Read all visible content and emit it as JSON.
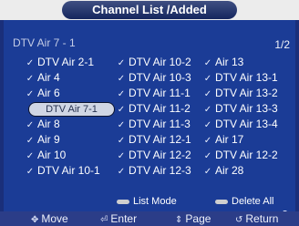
{
  "window": {
    "title": "Channel List /Added"
  },
  "header": {
    "subtitle": "DTV Air 7 - 1",
    "page": "1/2"
  },
  "channels": {
    "columns": [
      [
        "DTV Air 2-1",
        "Air 4",
        "Air 6",
        "DTV Air 7-1",
        "Air 8",
        "Air 9",
        "Air 10",
        "DTV Air 10-1"
      ],
      [
        "DTV Air 10-2",
        "DTV Air 10-3",
        "DTV Air 11-1",
        "DTV Air 11-2",
        "DTV Air 11-3",
        "DTV Air 12-1",
        "DTV Air 12-2",
        "DTV Air 12-3"
      ],
      [
        "Air 13",
        "DTV Air 13-1",
        "DTV Air 13-2",
        "DTV Air 13-3",
        "DTV Air 13-4",
        "Air 17",
        "DTV Air 12-2",
        "Air 28"
      ]
    ]
  },
  "actions": {
    "list_mode": "List Mode",
    "delete_all": "Delete All"
  },
  "footer": {
    "move": "Move",
    "enter": "Enter",
    "page": "Page",
    "return": "Return"
  },
  "colors": {
    "panel": "#1b3c96",
    "title_pill": "#15265e",
    "focus": "#d0d6e4"
  },
  "icons": {
    "check": "check-icon",
    "move": "move-icon",
    "enter": "enter-icon",
    "page": "page-icon",
    "return": "return-icon"
  }
}
